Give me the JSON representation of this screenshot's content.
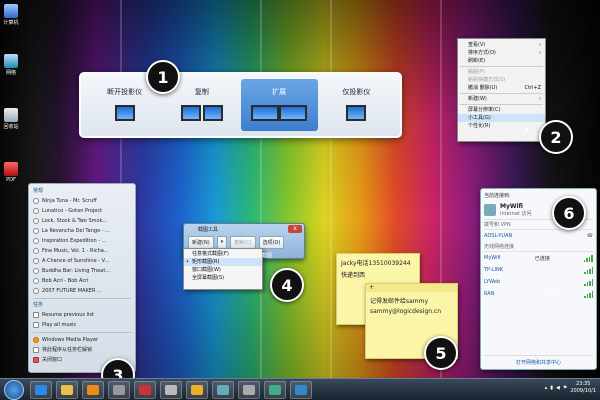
{
  "desktop": {
    "icons": [
      {
        "label": "计算机"
      },
      {
        "label": "网络"
      },
      {
        "label": "回收站"
      },
      {
        "label": "PDF"
      }
    ]
  },
  "badges": [
    "1",
    "2",
    "3",
    "4",
    "5",
    "6"
  ],
  "projection": {
    "options": [
      {
        "label": "断开投影仪"
      },
      {
        "label": "复制"
      },
      {
        "label": "扩展"
      },
      {
        "label": "仅投影仪"
      }
    ],
    "selected": "扩展"
  },
  "context_menu": {
    "items": [
      {
        "label": "查看(V)"
      },
      {
        "label": "排序方式(O)"
      },
      {
        "label": "刷新(E)"
      },
      {
        "label": "粘贴(P)",
        "disabled": true
      },
      {
        "label": "粘贴快捷方式(S)",
        "disabled": true
      },
      {
        "label": "撤消 删除(U)",
        "shortcut": "Ctrl+Z"
      },
      {
        "label": "新建(W)"
      },
      {
        "label": "屏幕分辨率(C)"
      },
      {
        "label": "小工具(G)",
        "highlighted": true
      },
      {
        "label": "个性化(R)"
      }
    ]
  },
  "jump_list": {
    "header": "常规",
    "tracks": [
      "Ninja Tuna - Mr. Scruff",
      "Lunatico - Gotan Project",
      "Lock, Stock & Two Smok...",
      "La Revancha Del Tango - ...",
      "Inspiration Expedition - ...",
      "Fine Music, Vol. 1 - Richa...",
      "A Chance of Sunshine - V...",
      "Buddha Bar: Living Theat...",
      "Bob Acri - Bob Acri",
      "2007 FUTURE MAKER ..."
    ],
    "tasks_header": "任务",
    "tasks": [
      "Resume previous list",
      "Play all music"
    ],
    "footer": [
      "Windows Media Player",
      "将此程序从任务栏解锁",
      "关闭窗口"
    ]
  },
  "dialog": {
    "title": "截图工具",
    "new_label": "新建(N)",
    "copy_label": "复制(C)",
    "options_label": "选项(O)",
    "close_label": "x",
    "dropdown": [
      "任意格式截图(F)",
      "矩形截图(R)",
      "窗口截图(W)",
      "全屏幕截图(S)"
    ],
    "side_text": "截图"
  },
  "notes": {
    "note1": [
      "Jacky电话13510039244",
      "快递到西"
    ],
    "note2_bar": "+",
    "note2": [
      "记得发邮件给sammy",
      "sammy@logicdesign.cn"
    ]
  },
  "wifi": {
    "header": "当前连接到:",
    "current_name": "MyWifi",
    "current_sub": "Internet 访问",
    "vpn_section": "拨号和 VPN",
    "vpn": "ADSL-YUAN",
    "wireless_section": "无线网络连接",
    "networks": [
      {
        "name": "MyWifi",
        "status": "已连接"
      },
      {
        "name": "TP-LINK",
        "status": ""
      },
      {
        "name": "LYWeb",
        "status": ""
      },
      {
        "name": "RAN",
        "status": ""
      }
    ],
    "footer": "打开网络和共享中心"
  },
  "taskbar": {
    "time": "23:35",
    "date": "2009/10/1"
  }
}
